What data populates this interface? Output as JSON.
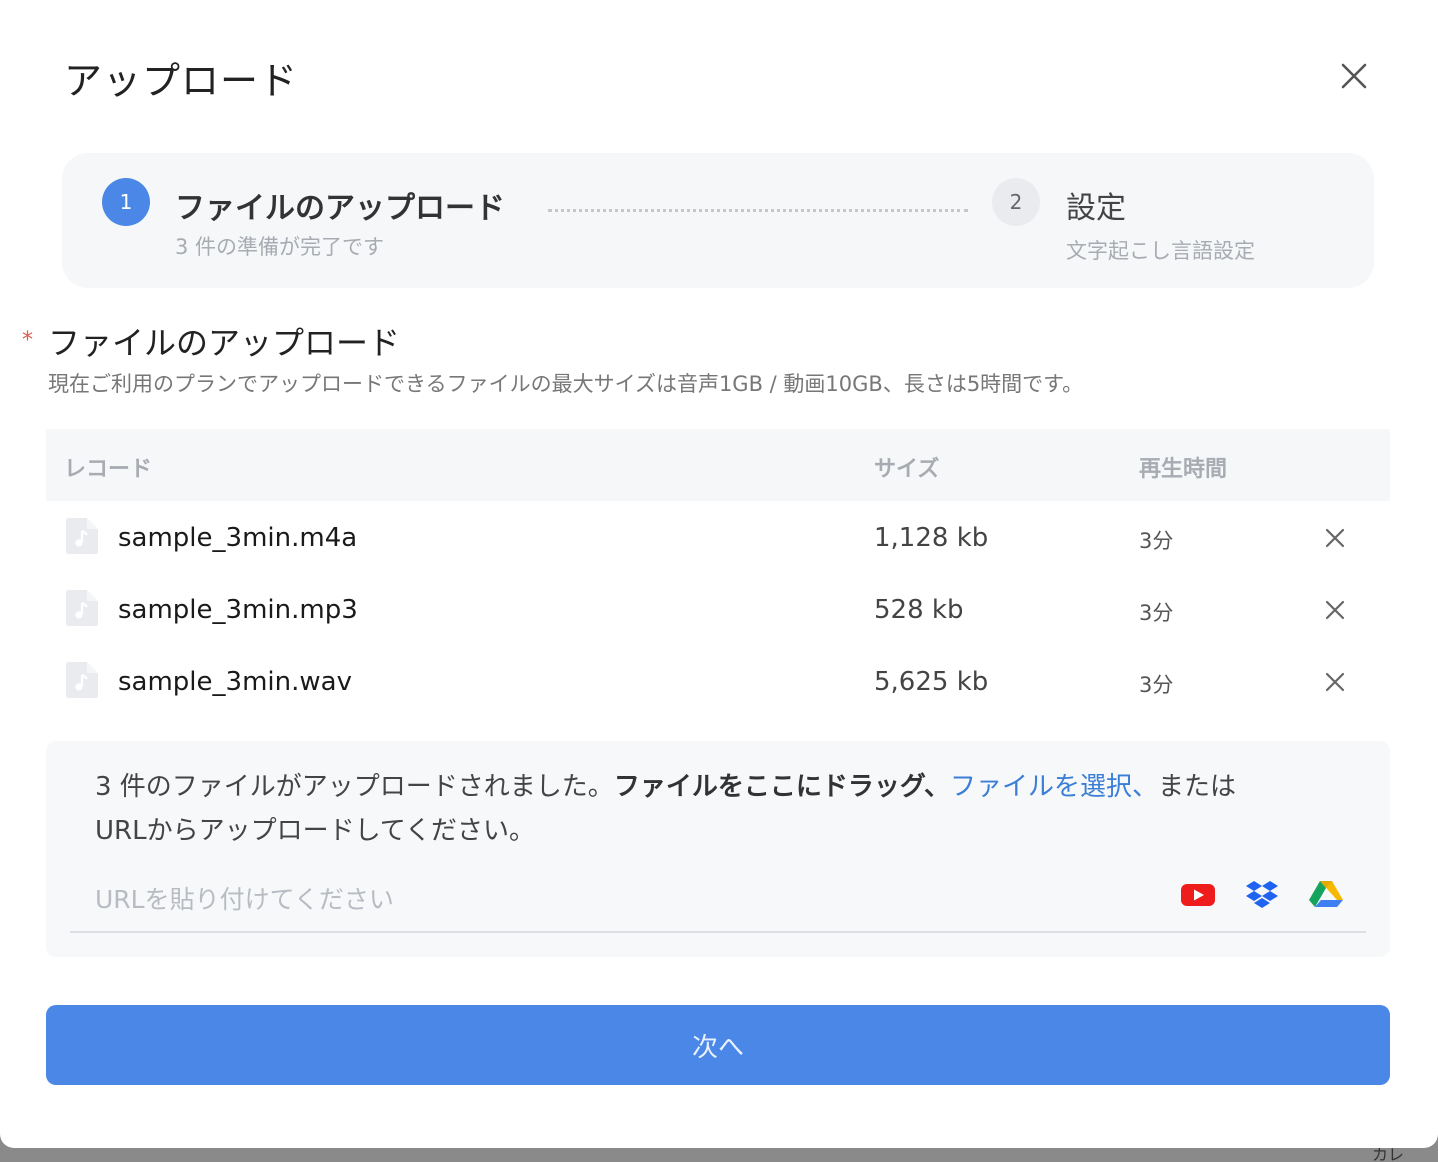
{
  "modal": {
    "title": "アップロード"
  },
  "stepper": {
    "steps": [
      {
        "number": "1",
        "title": "ファイルのアップロード",
        "subtitle": "3 件の準備が完了です"
      },
      {
        "number": "2",
        "title": "設定",
        "subtitle": "文字起こし言語設定"
      }
    ]
  },
  "section": {
    "required_mark": "*",
    "title": "ファイルのアップロード",
    "description": "現在ご利用のプランでアップロードできるファイルの最大サイズは音声1GB / 動画10GB、長さは5時間です。"
  },
  "table": {
    "headers": {
      "name": "レコード",
      "size": "サイズ",
      "duration": "再生時間"
    },
    "rows": [
      {
        "name": "sample_3min.m4a",
        "size": "1,128 kb",
        "duration": "3分"
      },
      {
        "name": "sample_3min.mp3",
        "size": "528 kb",
        "duration": "3分"
      },
      {
        "name": "sample_3min.wav",
        "size": "5,625 kb",
        "duration": "3分"
      }
    ]
  },
  "dropzone": {
    "status_text": "3 件のファイルがアップロードされました。",
    "drag_text": "ファイルをここにドラッグ、",
    "select_link": "ファイルを選択、",
    "or_text": "または",
    "url_text": "URLからアップロードしてください。",
    "url_placeholder": "URLを貼り付けてください"
  },
  "sources": [
    "youtube-icon",
    "dropbox-icon",
    "google-drive-icon"
  ],
  "next_button": {
    "label": "次へ"
  },
  "background": {
    "corner_text": "カレ"
  },
  "colors": {
    "accent": "#4a87e6",
    "link": "#3a7ed6",
    "required": "#e05a4e",
    "panel": "#f5f7f9"
  }
}
